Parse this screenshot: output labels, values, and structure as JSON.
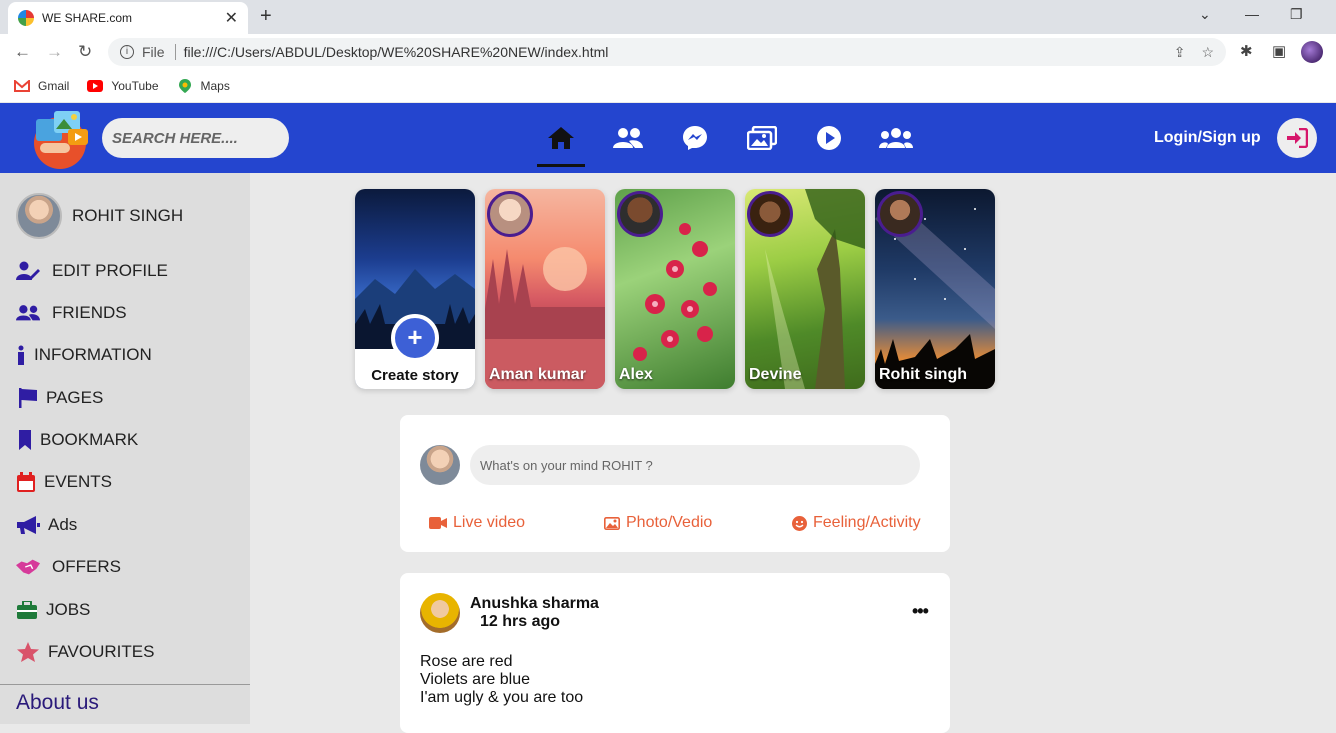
{
  "browser": {
    "tab_title": "WE SHARE.com",
    "new_tab": "+",
    "address_scheme": "File",
    "url": "file:///C:/Users/ABDUL/Desktop/WE%20SHARE%20NEW/index.html",
    "bookmarks": [
      {
        "label": "Gmail",
        "icon": "gmail-icon",
        "color": "#ea4335"
      },
      {
        "label": "YouTube",
        "icon": "youtube-icon",
        "color": "#ff0000"
      },
      {
        "label": "Maps",
        "icon": "maps-icon",
        "color": "#34a853"
      }
    ]
  },
  "header": {
    "search_placeholder": "SEARCH HERE....",
    "nav": [
      "home-icon",
      "friends-icon",
      "messenger-icon",
      "photos-icon",
      "watch-icon",
      "groups-icon"
    ],
    "login_label": "Login/Sign up",
    "accent": "#2445cf"
  },
  "sidebar": {
    "user_name": "ROHIT SINGH",
    "items": [
      {
        "label": "EDIT PROFILE",
        "icon": "user-edit-icon",
        "color": "#2f1da3"
      },
      {
        "label": "FRIENDS",
        "icon": "friends-icon",
        "color": "#2f1da3"
      },
      {
        "label": "INFORMATION",
        "icon": "info-icon",
        "color": "#2f1da3"
      },
      {
        "label": "PAGES",
        "icon": "flag-icon",
        "color": "#2f1da3"
      },
      {
        "label": "BOOKMARK",
        "icon": "bookmark-icon",
        "color": "#2f1da3"
      },
      {
        "label": "EVENTS",
        "icon": "calendar-icon",
        "color": "#e02020"
      },
      {
        "label": "Ads",
        "icon": "megaphone-icon",
        "color": "#2f1da3"
      },
      {
        "label": "OFFERS",
        "icon": "handshake-icon",
        "color": "#d63a9a"
      },
      {
        "label": "JOBS",
        "icon": "briefcase-icon",
        "color": "#1f7a3a"
      },
      {
        "label": "FAVOURITES",
        "icon": "star-icon",
        "color": "#d9536a"
      }
    ],
    "about": "About us"
  },
  "stories": {
    "create_label": "Create story",
    "items": [
      {
        "name": "Aman kumar"
      },
      {
        "name": "Alex"
      },
      {
        "name": "Devine"
      },
      {
        "name": "Rohit singh"
      }
    ]
  },
  "composer": {
    "placeholder": "What's on your mind ROHIT ?",
    "actions": [
      "Live video",
      "Photo/Vedio",
      "Feeling/Activity"
    ]
  },
  "post": {
    "author": "Anushka sharma",
    "time": "12 hrs ago",
    "more": "•••",
    "lines": [
      "Rose are red",
      "Violets are blue",
      "I'am ugly & you are too"
    ]
  }
}
